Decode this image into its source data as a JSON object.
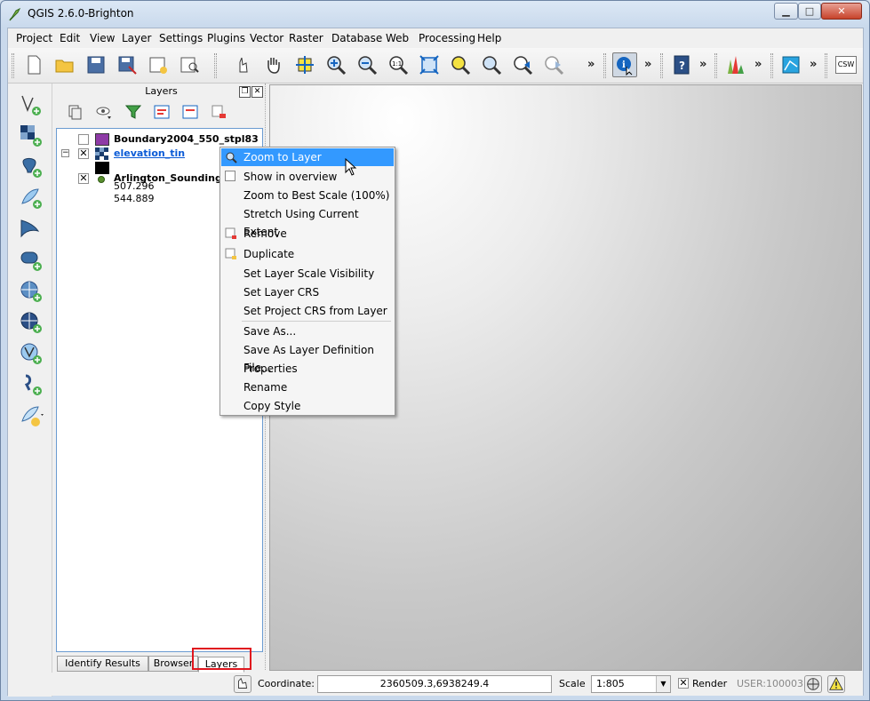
{
  "window": {
    "title": "QGIS 2.6.0-Brighton"
  },
  "menu": [
    "Project",
    "Edit",
    "View",
    "Layer",
    "Settings",
    "Plugins",
    "Vector",
    "Raster",
    "Database",
    "Web",
    "Processing",
    "Help"
  ],
  "toolbar": {
    "more_glyph": "»",
    "csw_label": "CSW"
  },
  "layers_panel": {
    "title": "Layers",
    "layers": [
      {
        "name": "Boundary2004_550_stpl83",
        "checked": false,
        "swatch": "#8e3aa6"
      },
      {
        "name": "elevation_tin",
        "checked": true,
        "selected": true,
        "legend": [
          "507.296",
          "544.889"
        ]
      },
      {
        "name": "Arlington_Soundings_",
        "checked": true,
        "swatch": "#5a8f2e"
      }
    ],
    "tabs": [
      "Identify Results",
      "Browser",
      "Layers"
    ]
  },
  "context_menu": {
    "items": [
      "Zoom to Layer",
      "Show in overview",
      "Zoom to Best Scale (100%)",
      "Stretch Using Current Extent",
      "Remove",
      "Duplicate",
      "Set Layer Scale Visibility",
      "Set Layer CRS",
      "Set Project CRS from Layer",
      "Save As...",
      "Save As Layer Definition File...",
      "Properties",
      "Rename",
      "Copy Style"
    ]
  },
  "status": {
    "coordinate_label": "Coordinate:",
    "coordinate_value": "2360509.3,6938249.4",
    "scale_label": "Scale",
    "scale_value": "1:805",
    "render_label": "Render",
    "user_label": "USER:100003"
  },
  "colors": {
    "highlight": "#3399ff",
    "tab_marker": "#e0161e"
  }
}
